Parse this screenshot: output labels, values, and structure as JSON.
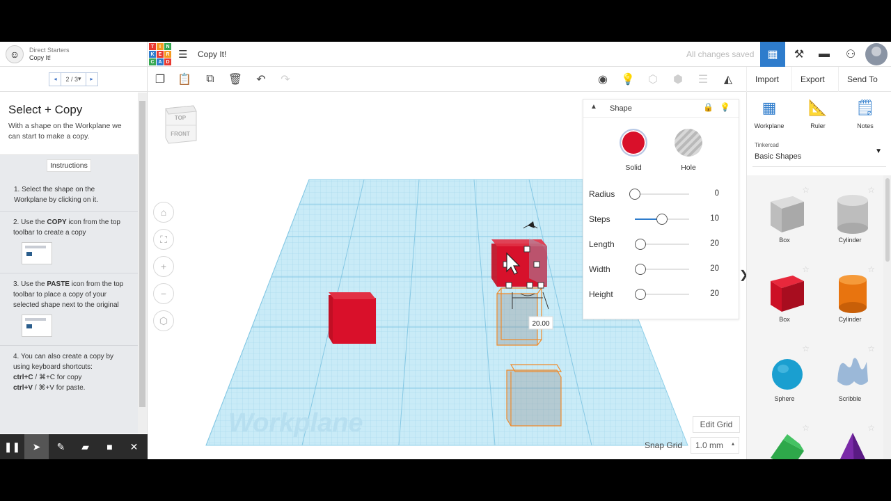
{
  "lesson": {
    "series": "Direct Starters",
    "name": "Copy It!",
    "pager": "2 / 3",
    "title": "Select + Copy",
    "intro": "With a shape on the Workplane we can start to make a copy.",
    "instructions_label": "Instructions",
    "steps": [
      {
        "num": "1.",
        "text": "Select the shape on the Workplane by clicking on it."
      },
      {
        "num": "2.",
        "pre": "Use the ",
        "bold": "COPY",
        "post": " icon from the top toolbar to create a copy"
      },
      {
        "num": "3.",
        "pre": "Use the ",
        "bold": "PASTE",
        "post": " icon from the top toolbar to place a copy of your selected shape next to the original"
      },
      {
        "num": "4.",
        "text": "You can also create a copy by using keyboard shortcuts:",
        "line2_bold": "ctrl+C",
        "line2_mid": " / ⌘+C",
        "line2_post": " for copy",
        "line3_bold": "ctrl+V",
        "line3_mid": " / ⌘+V",
        "line3_post": " for paste."
      }
    ]
  },
  "topbar": {
    "logo_letters": [
      "T",
      "I",
      "N",
      "K",
      "E",
      "R",
      "C",
      "A",
      "D"
    ],
    "logo_colors": [
      "#e8382f",
      "#f59a1f",
      "#36a852",
      "#2e7ccc",
      "#e8382f",
      "#f59a1f",
      "#36a852",
      "#2e7ccc",
      "#e8382f"
    ],
    "design_title": "Copy It!",
    "save_status": "All changes saved"
  },
  "toolbar": {
    "import": "Import",
    "export": "Export",
    "send_to": "Send To"
  },
  "viewcube": {
    "top": "TOP",
    "front": "FRONT"
  },
  "workplane": {
    "label": "Workplane",
    "dimension": "20.00"
  },
  "shape_panel": {
    "title": "Shape",
    "solid": "Solid",
    "hole": "Hole",
    "solid_color": "#d9102a",
    "props": [
      {
        "label": "Radius",
        "value": "0",
        "level": 0.0
      },
      {
        "label": "Steps",
        "value": "10",
        "level": 0.5
      },
      {
        "label": "Length",
        "value": "20",
        "level": 0.1
      },
      {
        "label": "Width",
        "value": "20",
        "level": 0.1
      },
      {
        "label": "Height",
        "value": "20",
        "level": 0.1
      }
    ]
  },
  "grid": {
    "edit_grid": "Edit Grid",
    "snap_label": "Snap Grid",
    "snap_value": "1.0 mm"
  },
  "library": {
    "tools": [
      "Workplane",
      "Ruler",
      "Notes"
    ],
    "source": "Tinkercad",
    "category": "Basic Shapes",
    "shapes": [
      "Box",
      "Cylinder",
      "Box",
      "Cylinder",
      "Sphere",
      "Scribble"
    ]
  },
  "colors": {
    "accent": "#2e7ccc",
    "box_red": "#d9102a",
    "cylinder_orange": "#f07a12",
    "sphere_blue": "#1a9fd0",
    "workplane_blue": "#bfe6f5"
  }
}
